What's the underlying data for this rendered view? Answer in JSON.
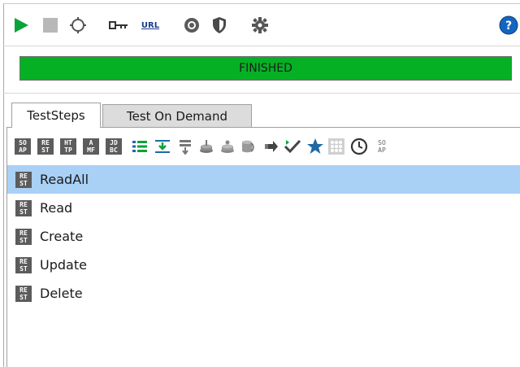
{
  "toolbar": {
    "url_label": "URL"
  },
  "progress": {
    "status": "FINISHED",
    "fraction": 1.0,
    "color": "#06b025"
  },
  "tabs": [
    {
      "label": "TestSteps",
      "active": true
    },
    {
      "label": "Test On Demand",
      "active": false
    }
  ],
  "step_toolbar": {
    "badges": [
      {
        "top": "SO",
        "bottom": "AP"
      },
      {
        "top": "RE",
        "bottom": "ST"
      },
      {
        "top": "HT",
        "bottom": "TP"
      },
      {
        "top": "A",
        "bottom": "MF"
      },
      {
        "top": "JD",
        "bottom": "BC"
      }
    ],
    "last_badge": {
      "top": "SO",
      "bottom": "AP"
    }
  },
  "steps": [
    {
      "label": "ReadAll",
      "selected": true,
      "badge_top": "RE",
      "badge_bottom": "ST"
    },
    {
      "label": "Read",
      "selected": false,
      "badge_top": "RE",
      "badge_bottom": "ST"
    },
    {
      "label": "Create",
      "selected": false,
      "badge_top": "RE",
      "badge_bottom": "ST"
    },
    {
      "label": "Update",
      "selected": false,
      "badge_top": "RE",
      "badge_bottom": "ST"
    },
    {
      "label": "Delete",
      "selected": false,
      "badge_top": "RE",
      "badge_bottom": "ST"
    }
  ],
  "colors": {
    "accent_green": "#0aa33a",
    "selection": "#a9d0f5",
    "star_blue": "#1f6aa5",
    "help_blue": "#1565c0"
  }
}
